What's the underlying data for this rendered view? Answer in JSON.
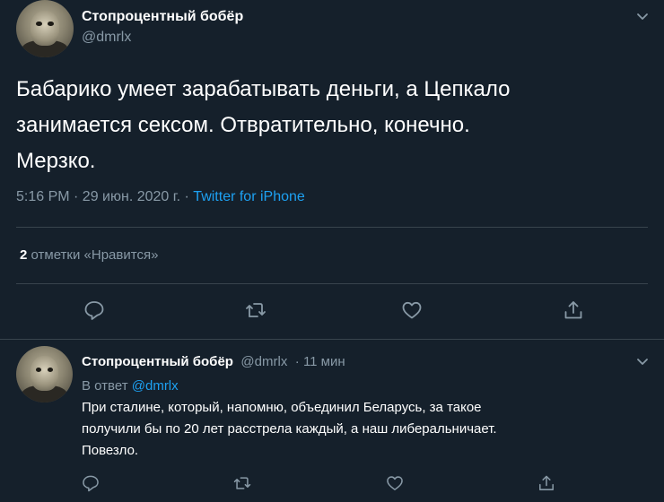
{
  "main_tweet": {
    "author_name": "Стопроцентный бобёр",
    "author_handle": "@dmrlx",
    "text_lines": [
      "Бабарико умеет зарабатывать деньги, а Цепкало",
      "занимается сексом.  Отвратительно, конечно.",
      "Мерзко."
    ],
    "time": "5:16 PM · 29 июн. 2020 г. · ",
    "source": "Twitter for iPhone",
    "likes_count": "2",
    "likes_label": "отметки «Нравится»"
  },
  "reply_tweet": {
    "author_name": "Стопроцентный бобёр",
    "author_handle": "@dmrlx",
    "time_ago": "· 11 мин",
    "reply_to_prefix": "В ответ",
    "reply_to_handle": "@dmrlx",
    "text_lines": [
      "При сталине, который, напомню, объединил Беларусь, за такое",
      "получили бы по 20 лет расстрела каждый, а наш либеральничает.",
      "Повезло."
    ]
  },
  "icons": {
    "reply": "reply-icon",
    "retweet": "retweet-icon",
    "like": "heart-icon",
    "share": "share-icon",
    "menu": "chevron-down-icon"
  },
  "colors": {
    "background": "#15202b",
    "secondary_text": "#8899a6",
    "link": "#1da1f2",
    "divider": "#38444d"
  }
}
